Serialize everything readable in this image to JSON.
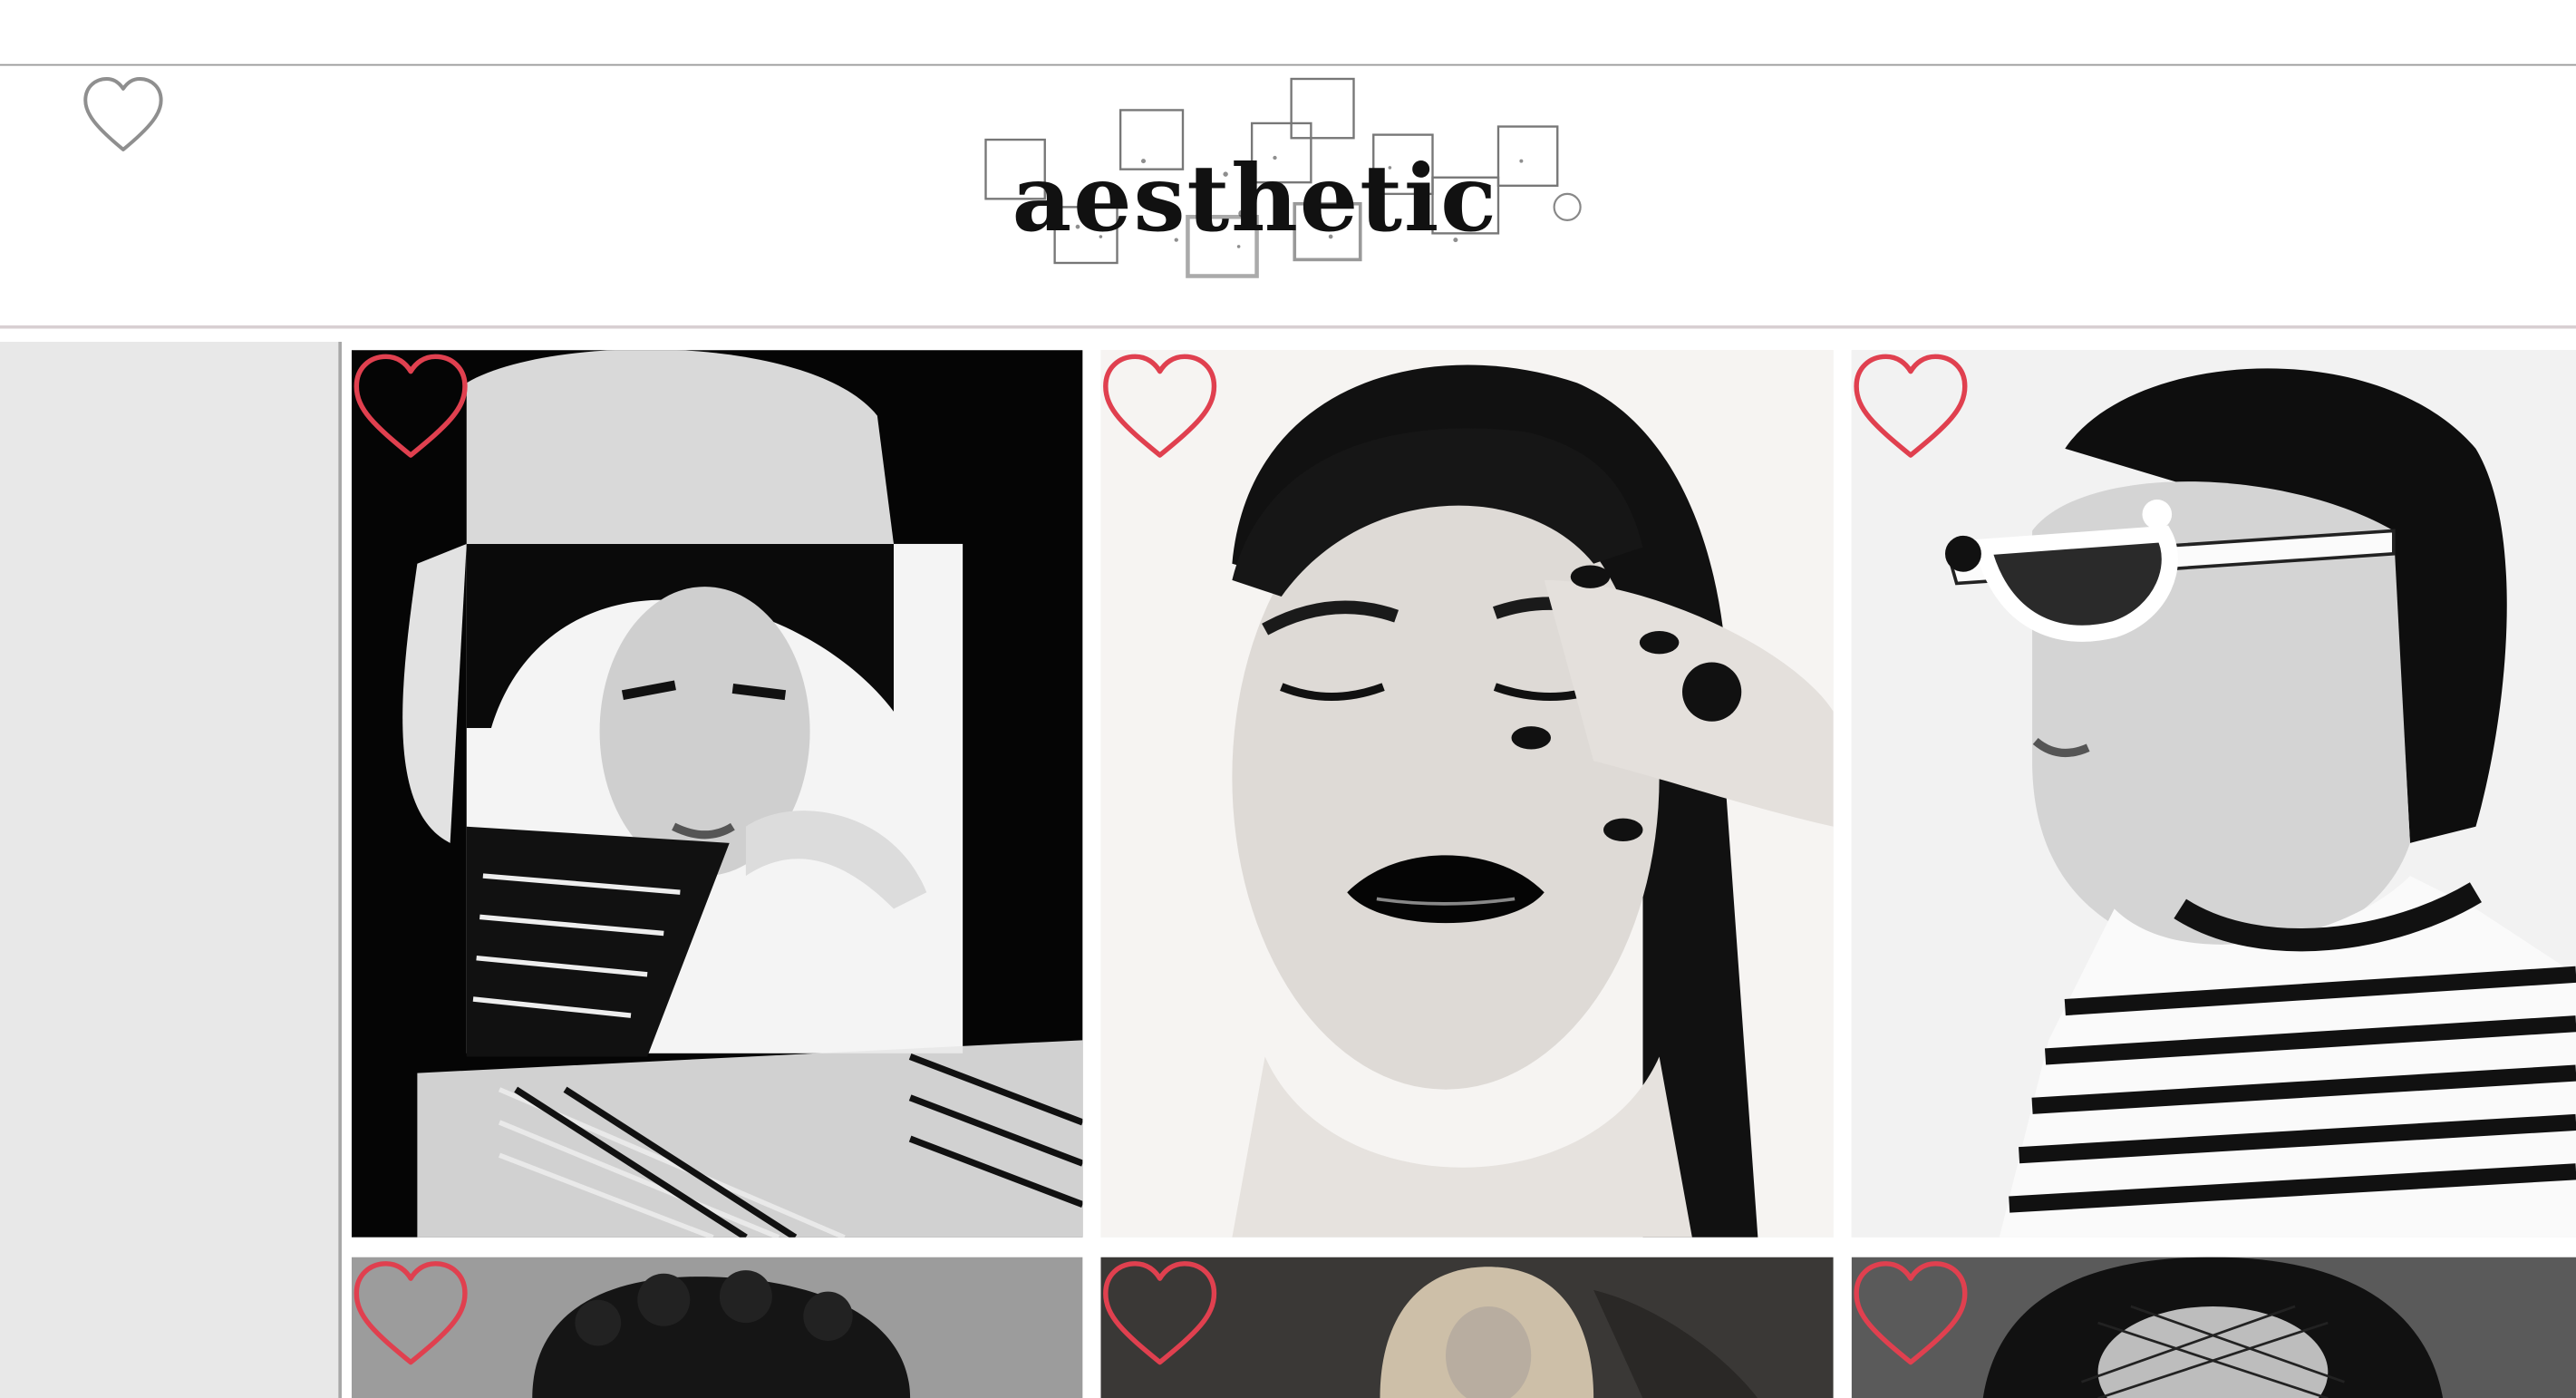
{
  "header": {
    "logo_text": "aesthetic",
    "favorites_icon": "heart-outline-icon"
  },
  "gallery": {
    "like_icon": "heart-outline-icon",
    "accent_color": "#e0404f",
    "tiles": [
      {
        "name": "photo-bob-wig-collage",
        "tone": "mixed",
        "liked": false
      },
      {
        "name": "photo-black-lips",
        "tone": "light",
        "liked": false
      },
      {
        "name": "photo-sunglasses-stripes",
        "tone": "light",
        "liked": false
      },
      {
        "name": "photo-curly-hair",
        "tone": "gray",
        "liked": false
      },
      {
        "name": "photo-blonde-dark",
        "tone": "dark",
        "liked": false
      },
      {
        "name": "photo-veil-hat",
        "tone": "dark",
        "liked": false
      }
    ]
  }
}
